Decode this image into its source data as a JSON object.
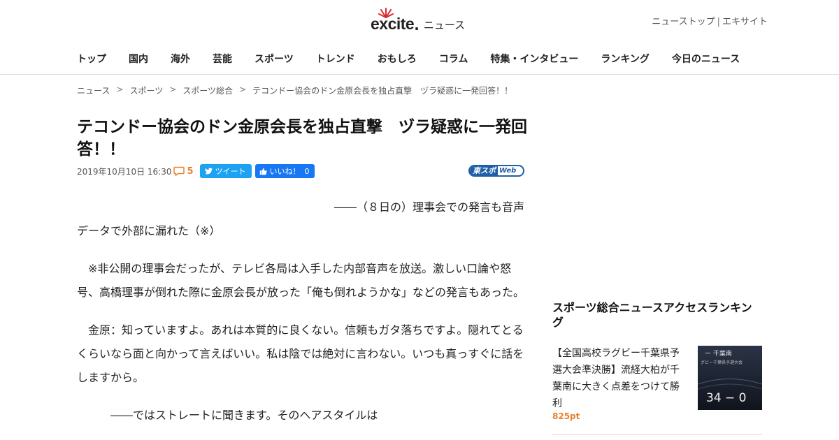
{
  "header": {
    "logo_text": "excite",
    "logo_suffix": "ニュース",
    "top_links": [
      "ニューストップ",
      "エキサイト"
    ],
    "top_links_separator": "|"
  },
  "nav": {
    "items": [
      "トップ",
      "国内",
      "海外",
      "芸能",
      "スポーツ",
      "トレンド",
      "おもしろ",
      "コラム",
      "特集・インタビュー",
      "ランキング",
      "今日のニュース"
    ]
  },
  "breadcrumb": {
    "items": [
      "ニュース",
      "スポーツ",
      "スポーツ総合",
      "テコンドー協会のドン金原会長を独占直撃　ヅラ疑惑に一発回答！！"
    ],
    "separator": ">"
  },
  "article": {
    "title": "テコンドー協会のドン金原会長を独占直撃　ヅラ疑惑に一発回答！！",
    "date": "2019年10月10日 16:30",
    "comment_count": "5",
    "tweet_label": "ツイート",
    "like_label": "いいね！",
    "like_count": "0",
    "source_logo_jp": "東スポ",
    "source_logo_web": "Web",
    "paragraphs": {
      "p1_line1": "――（８日の）理事会での発言も音声",
      "p1_line2": "データで外部に漏れた（※）",
      "p2": "※非公開の理事会だったが、テレビ各局は入手した内部音声を放送。激しい口論や怒号、高橋理事が倒れた際に金原会長が放った「俺も倒れようかな」などの発言もあった。",
      "p3": "金原：知っていますよ。あれは本質的に良くない。信頼もガタ落ちですよ。隠れてとるくらいなら面と向かって言えばいい。私は陰では絶対に言わない。いつも真っすぐに話をしますから。",
      "p4": "――ではストレートに聞きます。そのヘアスタイルは"
    }
  },
  "sidebar": {
    "ranking_title": "スポーツ総合ニュースアクセスランキング",
    "items": [
      {
        "text": "【全国高校ラグビー千葉県予選大会準決勝】流経大柏が千葉南に大きく点差をつけて勝利",
        "points": "825pt",
        "thumb_score": "34 − 0",
        "thumb_caption_1": "ー 千葉南",
        "thumb_caption_2": "グビー千葉県予選大会"
      }
    ]
  },
  "colors": {
    "accent_orange": "#e8812b",
    "twitter_blue": "#1da1f2",
    "facebook_blue": "#1877f2",
    "tosupo_blue": "#1f5ea8",
    "logo_red": "#d7282f"
  }
}
